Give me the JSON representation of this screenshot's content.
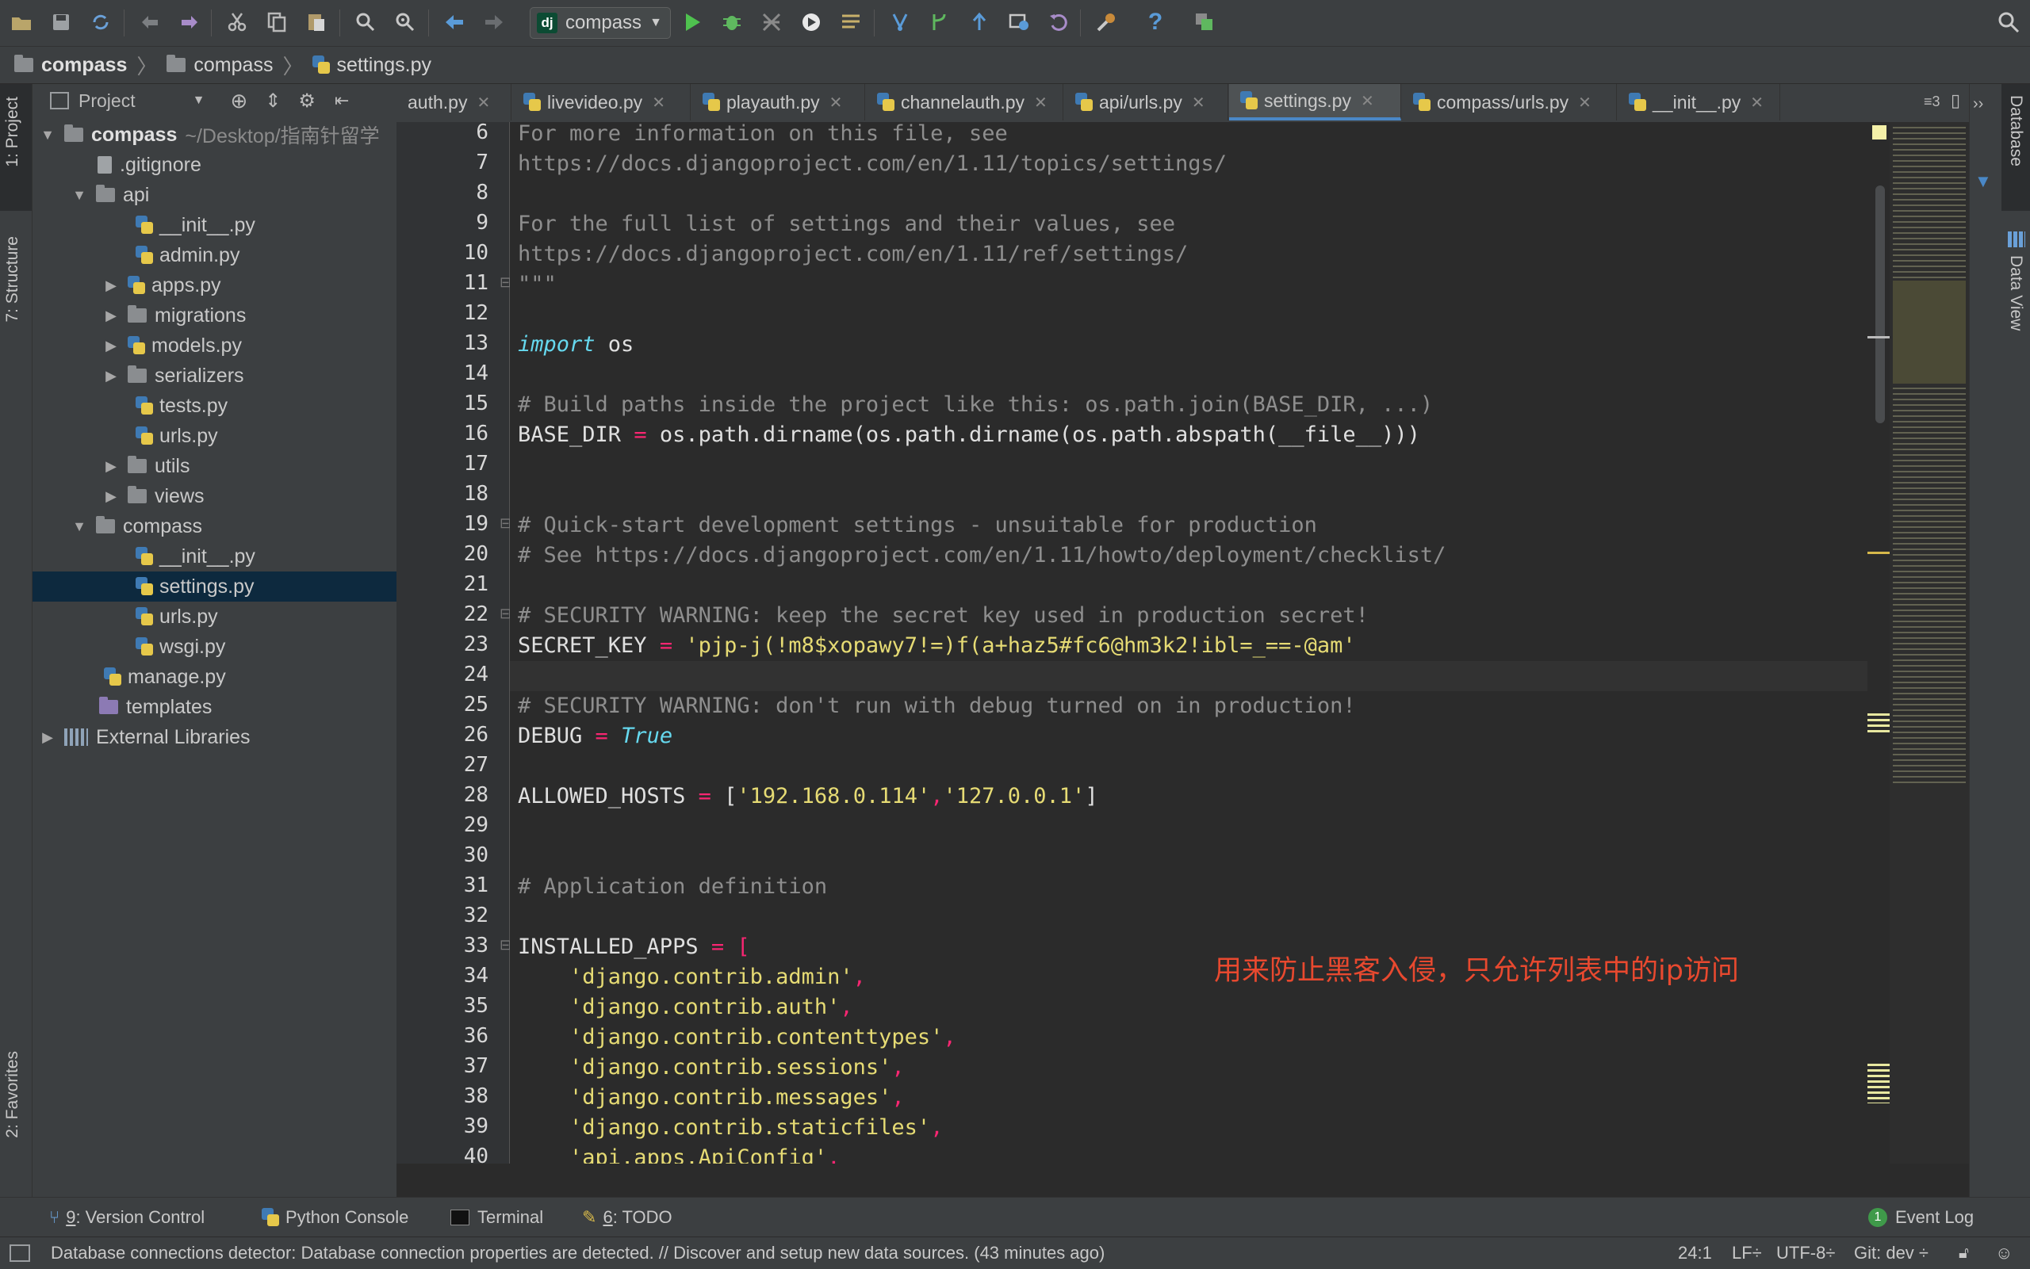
{
  "toolbar": {
    "run_config": "compass",
    "run_config_badge": "dj"
  },
  "breadcrumb": [
    "compass",
    "compass",
    "settings.py"
  ],
  "project_panel": {
    "title": "Project",
    "root_name": "compass",
    "root_path": "~/Desktop/指南针留学",
    "items": [
      {
        "label": ".gitignore"
      },
      {
        "label": "api"
      },
      {
        "label": "__init__.py"
      },
      {
        "label": "admin.py"
      },
      {
        "label": "apps.py"
      },
      {
        "label": "migrations"
      },
      {
        "label": "models.py"
      },
      {
        "label": "serializers"
      },
      {
        "label": "tests.py"
      },
      {
        "label": "urls.py"
      },
      {
        "label": "utils"
      },
      {
        "label": "views"
      },
      {
        "label": "compass"
      },
      {
        "label": "__init__.py"
      },
      {
        "label": "settings.py"
      },
      {
        "label": "urls.py"
      },
      {
        "label": "wsgi.py"
      },
      {
        "label": "manage.py"
      },
      {
        "label": "templates"
      },
      {
        "label": "External Libraries"
      }
    ]
  },
  "tabs": [
    {
      "label": "auth.py"
    },
    {
      "label": "livevideo.py"
    },
    {
      "label": "playauth.py"
    },
    {
      "label": "channelauth.py"
    },
    {
      "label": "api/urls.py"
    },
    {
      "label": "settings.py"
    },
    {
      "label": "compass/urls.py"
    },
    {
      "label": "__init__.py"
    }
  ],
  "tab_overflow": "3",
  "code": {
    "line_numbers": [
      "6",
      "7",
      "8",
      "9",
      "10",
      "11",
      "12",
      "13",
      "14",
      "15",
      "16",
      "17",
      "18",
      "19",
      "20",
      "21",
      "22",
      "23",
      "24",
      "25",
      "26",
      "27",
      "28",
      "29",
      "30",
      "31",
      "32",
      "33",
      "34",
      "35",
      "36",
      "37",
      "38",
      "39",
      "40"
    ],
    "l6": "For more information on this file, see",
    "l7": "https://docs.djangoproject.com/en/1.11/topics/settings/",
    "l9": "For the full list of settings and their values, see",
    "l10": "https://docs.djangoproject.com/en/1.11/ref/settings/",
    "l11": "\"\"\"",
    "l13_kw": "import",
    "l13_rest": " os",
    "l15": "# Build paths inside the project like this: os.path.join(BASE_DIR, ...)",
    "l16_name": "BASE_DIR",
    "l16_rest": "os.path.dirname(os.path.dirname(os.path.abspath(__file__)))",
    "l19": "# Quick-start development settings - unsuitable for production",
    "l20": "# See https://docs.djangoproject.com/en/1.11/howto/deployment/checklist/",
    "l22": "# SECURITY WARNING: keep the secret key used in production secret!",
    "l23_name": "SECRET_KEY",
    "l23_value": "'pjp-j(!m8$xopawy7!=)f(a+haz5#fc6@hm3k2!ibl=_==-@am'",
    "l25": "# SECURITY WARNING: don't run with debug turned on in production!",
    "l26_name": "DEBUG",
    "l26_value": "True",
    "l28_name": "ALLOWED_HOSTS",
    "l28_v1": "'192.168.0.114'",
    "l28_v2": "'127.0.0.1'",
    "l31": "# Application definition",
    "l33_name": "INSTALLED_APPS",
    "apps": [
      "'django.contrib.admin'",
      "'django.contrib.auth'",
      "'django.contrib.contenttypes'",
      "'django.contrib.sessions'",
      "'django.contrib.messages'",
      "'django.contrib.staticfiles'",
      "'api.apps.ApiConfig'"
    ],
    "eq": "=",
    "lbr": "[",
    "rbr": "]",
    "comma": ","
  },
  "annotation": "用来防止黑客入侵，只允许列表中的ip访问",
  "left_strip": {
    "project_tab": "1: Project",
    "structure_tab": "7: Structure",
    "favorites_tab": "2: Favorites"
  },
  "right_strip": {
    "database_tab": "Database",
    "dataview_tab": "Data View"
  },
  "tool_tabs": {
    "vcs_num": "9",
    "vcs_label": ": Version Control",
    "python_console": "Python Console",
    "terminal": "Terminal",
    "todo_num": "6",
    "todo_label": ": TODO",
    "event_log_count": "1",
    "event_log": "Event Log"
  },
  "status_bar": {
    "message": "Database connections detector: Database connection properties are detected. // Discover and setup new data sources. (43 minutes ago)",
    "position": "24:1",
    "line_sep": "LF÷",
    "encoding": "UTF-8÷",
    "git": "Git: dev ÷"
  },
  "colors": {
    "accent": "#4a88c7",
    "selection": "#0d293e",
    "annotation": "#e8492f"
  }
}
